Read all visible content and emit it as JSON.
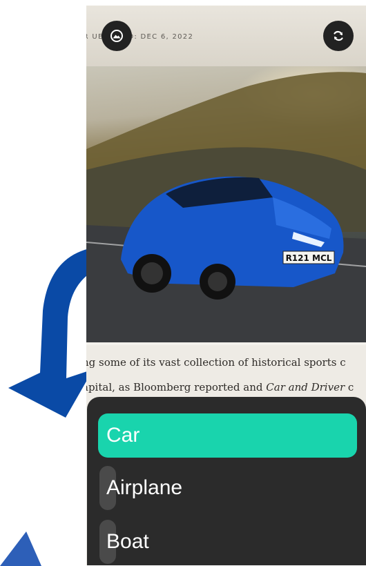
{
  "article": {
    "byline": "ER        UBLISHED: DEC 6, 2022",
    "line1": "ng some of its vast collection of historical sports c",
    "line2_a": "apital, as Bloomberg reported and ",
    "line2_b": "Car and Driver",
    "line2_c": " c",
    "plate": "R121 MCL"
  },
  "overlay_buttons": {
    "left_icon": "gallery-icon",
    "right_icon": "refresh-icon"
  },
  "menu": {
    "options": [
      {
        "label": "Car",
        "selected": true
      },
      {
        "label": "Airplane",
        "selected": false
      },
      {
        "label": "Boat",
        "selected": false
      }
    ],
    "selected_color": "#19d4ad",
    "background_color": "#2b2b2b"
  },
  "decor": {
    "arrow_color": "#0a4aa6",
    "corner_color": "#2d5fb8"
  }
}
